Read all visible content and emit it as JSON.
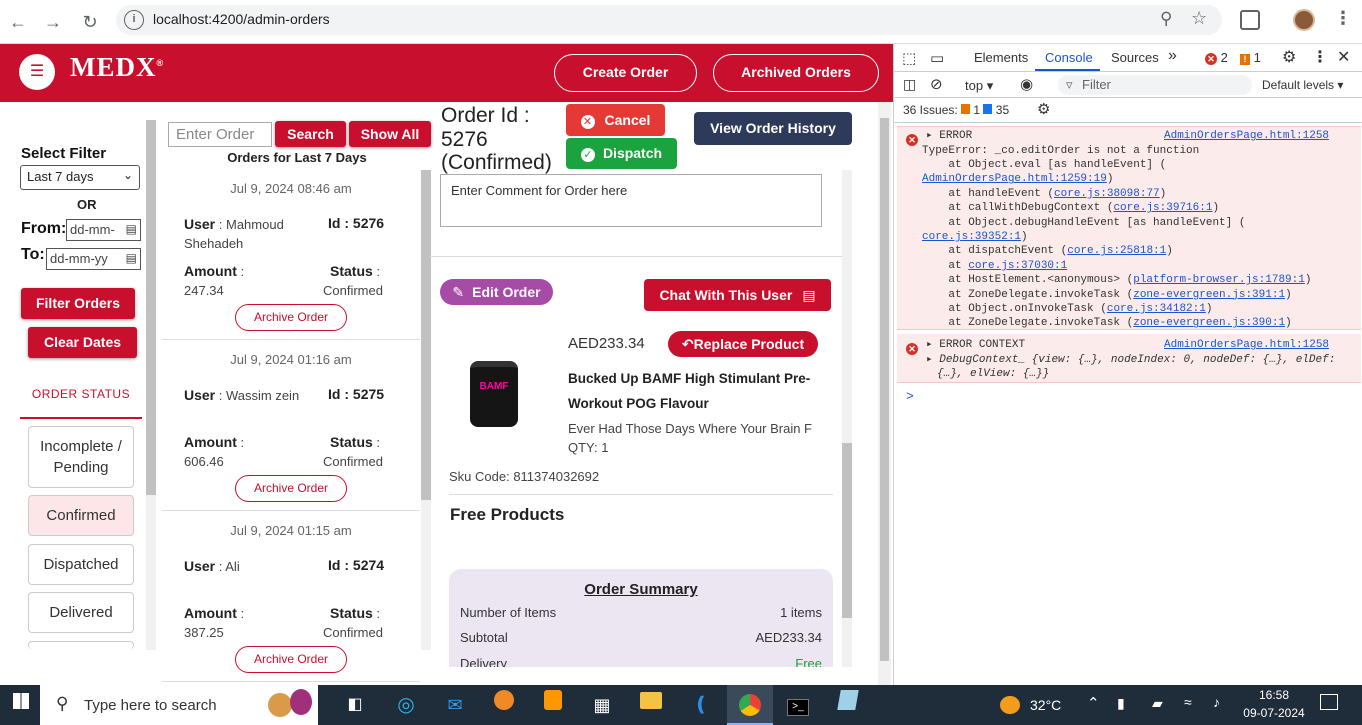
{
  "browser": {
    "url": "localhost:4200/admin-orders"
  },
  "header": {
    "logo": "MEDX",
    "logo_mark": "®",
    "create_order": "Create Order",
    "archived_orders": "Archived Orders"
  },
  "filter": {
    "title": "Select Filter",
    "selected": "Last 7 days",
    "or": "OR",
    "from_label": "From:",
    "to_label": "To:",
    "from_placeholder": "dd-mm-",
    "to_placeholder": "dd-mm-yy",
    "filter_button": "Filter Orders",
    "clear_button": "Clear Dates",
    "status_heading": "ORDER STATUS",
    "statuses": [
      "Incomplete / Pending",
      "Confirmed",
      "Dispatched",
      "Delivered"
    ]
  },
  "orders_panel": {
    "search_placeholder": "Enter Order",
    "search_button": "Search",
    "show_all_button": "Show All",
    "heading": "Orders for Last 7 Days",
    "user_label": "User",
    "id_label": "Id",
    "amount_label": "Amount",
    "status_label": "Status",
    "archive_label": "Archive Order",
    "orders": [
      {
        "date": "Jul 9, 2024 08:46 am",
        "user": "Mahmoud Shehadeh",
        "id": "5276",
        "amount": "247.34",
        "status": "Confirmed"
      },
      {
        "date": "Jul 9, 2024 01:16 am",
        "user": "Wassim zein",
        "id": "5275",
        "amount": "606.46",
        "status": "Confirmed"
      },
      {
        "date": "Jul 9, 2024 01:15 am",
        "user": "Ali",
        "id": "5274",
        "amount": "387.25",
        "status": "Confirmed"
      }
    ]
  },
  "detail": {
    "order_id_line1": "Order Id :",
    "order_id_line2": "5276",
    "order_id_line3": "(Confirmed)",
    "cancel": "Cancel",
    "dispatch": "Dispatch",
    "view_history": "View Order History",
    "comment_placeholder": "Enter Comment for Order here",
    "edit_order": "Edit Order",
    "chat_user": "Chat With This User",
    "product": {
      "price": "AED233.34",
      "replace": "Replace Product",
      "name_line1": "Bucked Up BAMF High Stimulant Pre-",
      "name_line2": "Workout POG Flavour",
      "description": "Ever Had Those Days Where Your Brain F",
      "qty": "QTY: 1",
      "sku": "Sku Code: 811374032692",
      "image_label": "BAMF"
    },
    "free_products": "Free Products",
    "summary": {
      "title": "Order Summary",
      "rows": [
        {
          "label": "Number of Items",
          "value": "1 items"
        },
        {
          "label": "Subtotal",
          "value": "AED233.34"
        },
        {
          "label": "Delivery",
          "value": "Free"
        }
      ]
    }
  },
  "devtools": {
    "tabs": [
      "Elements",
      "Console",
      "Sources"
    ],
    "active_tab": "Console",
    "errors_count": "2",
    "warnings_count": "1",
    "context": "top",
    "filter_placeholder": "Filter",
    "levels": "Default levels",
    "issues_label": "36 Issues:",
    "issues_warn": "1",
    "issues_info": "35",
    "error1": {
      "title": "ERROR",
      "source": "AdminOrdersPage.html:1258",
      "message": "TypeError: _co.editOrder is not a function",
      "stack": [
        {
          "pre": "    at Object.eval [as handleEvent] (",
          "link": "",
          "post": ""
        },
        {
          "pre": "",
          "link": "AdminOrdersPage.html:1259:19",
          "post": ")"
        },
        {
          "pre": "    at handleEvent (",
          "link": "core.js:38098:77",
          "post": ")"
        },
        {
          "pre": "    at callWithDebugContext (",
          "link": "core.js:39716:1",
          "post": ")"
        },
        {
          "pre": "    at Object.debugHandleEvent [as handleEvent] (",
          "link": "",
          "post": ""
        },
        {
          "pre": "",
          "link": "core.js:39352:1",
          "post": ")"
        },
        {
          "pre": "    at dispatchEvent (",
          "link": "core.js:25818:1",
          "post": ")"
        },
        {
          "pre": "    at ",
          "link": "core.js:37030:1",
          "post": ""
        },
        {
          "pre": "    at HostElement.<anonymous> (",
          "link": "platform-browser.js:1789:1",
          "post": ")"
        },
        {
          "pre": "    at ZoneDelegate.invokeTask (",
          "link": "zone-evergreen.js:391:1",
          "post": ")"
        },
        {
          "pre": "    at Object.onInvokeTask (",
          "link": "core.js:34182:1",
          "post": ")"
        },
        {
          "pre": "    at ZoneDelegate.invokeTask (",
          "link": "zone-evergreen.js:390:1",
          "post": ")"
        }
      ]
    },
    "error2": {
      "title": "ERROR CONTEXT",
      "source": "AdminOrdersPage.html:1258",
      "line1": "DebugContext_ {view: {…}, nodeIndex: 0, nodeDef: {…}, elDef:",
      "line2": "{…}, elView: {…}}"
    },
    "prompt": ">"
  },
  "taskbar": {
    "search_placeholder": "Type here to search",
    "weather": "32°C",
    "time": "16:58",
    "date": "09-07-2024"
  },
  "colors": {
    "brand": "#c8102e",
    "cancel": "#e53935",
    "dispatch": "#1aa33e",
    "history": "#2d3a5a",
    "edit": "#a64ca6"
  }
}
